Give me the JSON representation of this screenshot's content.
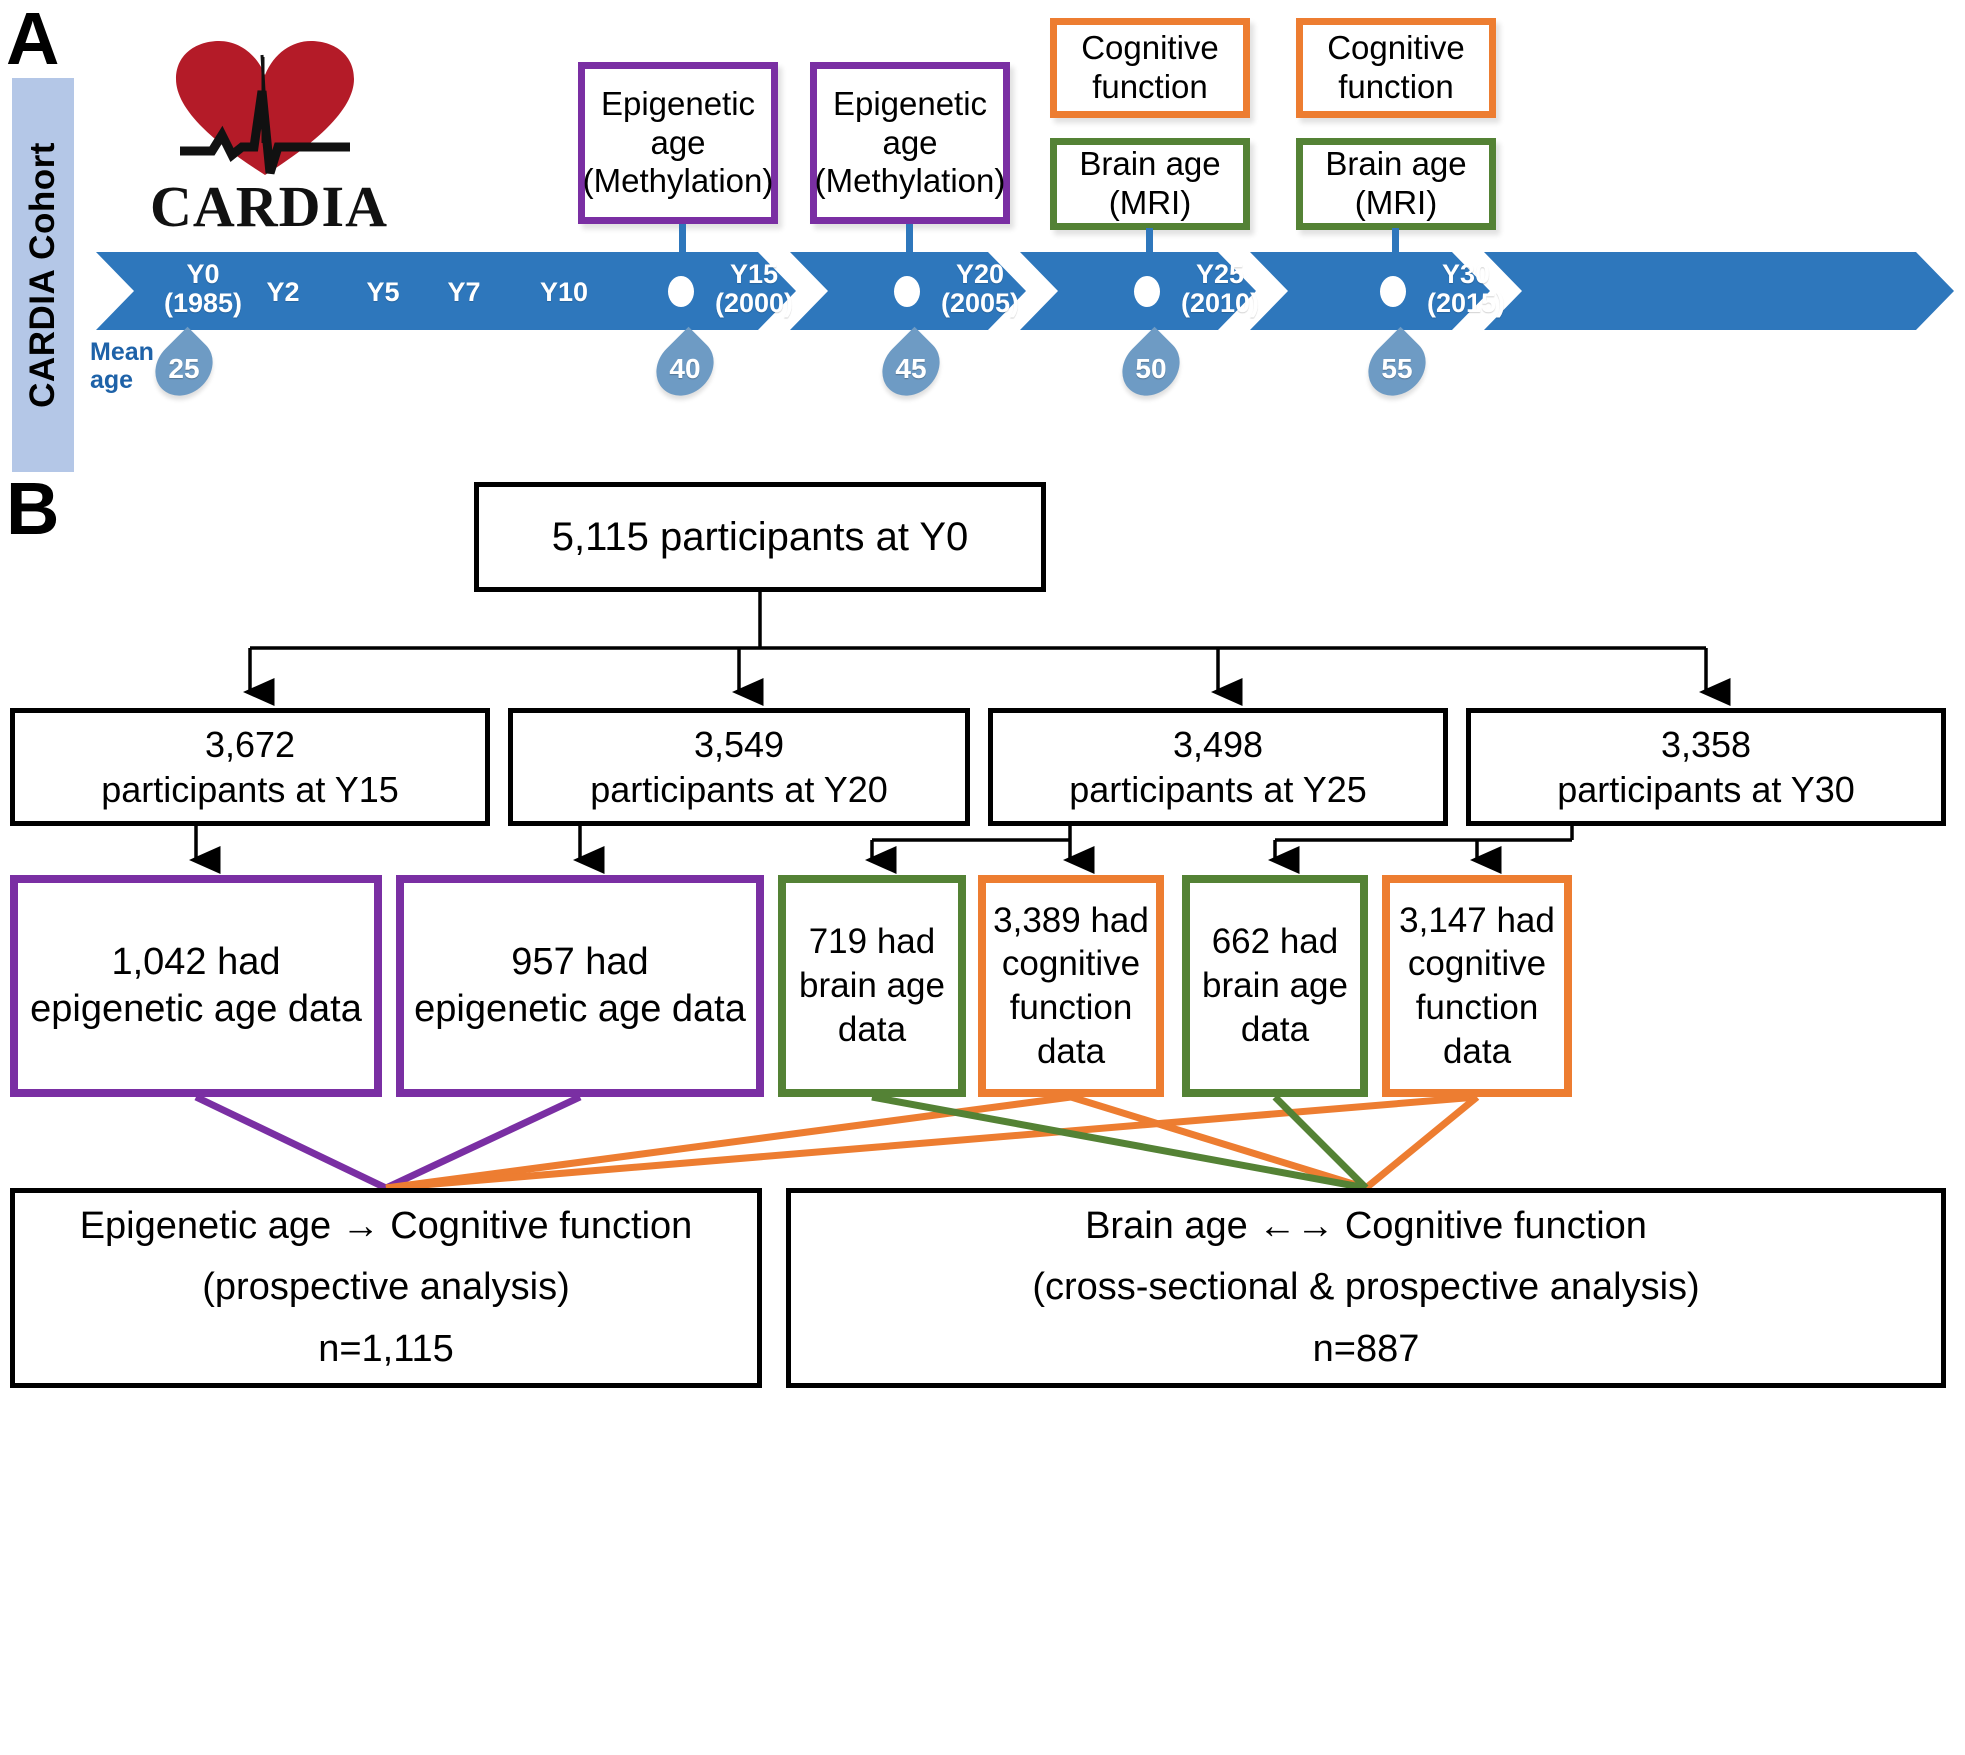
{
  "figure": {
    "panel_a_letter": "A",
    "panel_b_letter": "B"
  },
  "panel_a": {
    "sidebar_label": "CARDIA Cohort",
    "logo_wordmark": "CARDIA",
    "logo_icon": "heart-ecg-icon",
    "mean_age_label_line1": "Mean",
    "mean_age_label_line2": "age",
    "timeline": {
      "ticks": [
        {
          "year": "Y0",
          "date": "(1985)",
          "has_dot": false
        },
        {
          "year": "Y2",
          "date": "",
          "has_dot": false
        },
        {
          "year": "Y5",
          "date": "",
          "has_dot": false
        },
        {
          "year": "Y7",
          "date": "",
          "has_dot": false
        },
        {
          "year": "Y10",
          "date": "",
          "has_dot": false
        },
        {
          "year": "Y15",
          "date": "(2000)",
          "has_dot": true
        },
        {
          "year": "Y20",
          "date": "(2005)",
          "has_dot": true
        },
        {
          "year": "Y25",
          "date": "(2010)",
          "has_dot": true
        },
        {
          "year": "Y30",
          "date": "(2015)",
          "has_dot": true
        }
      ],
      "mean_ages": [
        "25",
        "40",
        "45",
        "50",
        "55"
      ]
    },
    "measure_boxes": [
      {
        "line1": "Epigenetic age",
        "line2": "(Methylation)",
        "color": "purple"
      },
      {
        "line1": "Epigenetic age",
        "line2": "(Methylation)",
        "color": "purple"
      },
      {
        "line1": "Cognitive",
        "line2": "function",
        "color": "orange"
      },
      {
        "line1": "Brain age",
        "line2": "(MRI)",
        "color": "green"
      },
      {
        "line1": "Cognitive",
        "line2": "function",
        "color": "orange"
      },
      {
        "line1": "Brain age",
        "line2": "(MRI)",
        "color": "green"
      }
    ]
  },
  "panel_b": {
    "top_box": "5,115 participants at Y0",
    "cohort_boxes": [
      {
        "count": "3,672",
        "label": "participants at Y15"
      },
      {
        "count": "3,549",
        "label": "participants at Y20"
      },
      {
        "count": "3,498",
        "label": "participants at Y25"
      },
      {
        "count": "3,358",
        "label": "participants at Y30"
      }
    ],
    "data_boxes": [
      {
        "line1": "1,042 had",
        "line2": "epigenetic age data",
        "line3": "",
        "color": "purple"
      },
      {
        "line1": "957 had",
        "line2": "epigenetic age data",
        "line3": "",
        "color": "purple"
      },
      {
        "line1": "719 had",
        "line2": "brain age",
        "line3": "data",
        "color": "green"
      },
      {
        "line1": "3,389 had",
        "line2": "cognitive",
        "line3": "function data",
        "color": "orange"
      },
      {
        "line1": "662 had",
        "line2": "brain age",
        "line3": "data",
        "color": "green"
      },
      {
        "line1": "3,147 had",
        "line2": "cognitive",
        "line3": "function data",
        "color": "orange"
      }
    ],
    "analysis_left": {
      "title": "Epigenetic age → Cognitive function",
      "subtitle": "(prospective analysis)",
      "n": "n=1,115"
    },
    "analysis_right": {
      "title": "Brain age ←→ Cognitive function",
      "subtitle": "(cross-sectional & prospective analysis)",
      "n": "n=887"
    }
  },
  "colors": {
    "purple": "#7A2FA3",
    "orange": "#ED7D31",
    "green": "#548235",
    "timeline_blue": "#2E77BC",
    "sidebar_blue": "#b4c7e7",
    "drop_blue": "#6E9BC4",
    "logo_red": "#B41B28",
    "black": "#000000"
  }
}
